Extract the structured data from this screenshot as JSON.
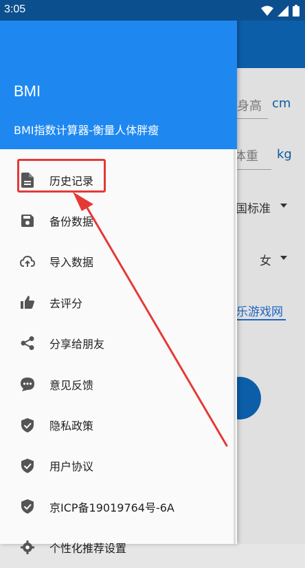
{
  "status_bar": {
    "time": "3:05"
  },
  "drawer": {
    "title": "BMI",
    "subtitle": "BMI指数计算器-衡量人体胖瘦",
    "items": [
      {
        "label": "历史记录",
        "icon": "document-icon"
      },
      {
        "label": "备份数据",
        "icon": "save-icon"
      },
      {
        "label": "导入数据",
        "icon": "cloud-upload-icon"
      },
      {
        "label": "去评分",
        "icon": "thumb-up-icon"
      },
      {
        "label": "分享给朋友",
        "icon": "share-icon"
      },
      {
        "label": "意见反馈",
        "icon": "feedback-icon"
      },
      {
        "label": "隐私政策",
        "icon": "shield-check-icon"
      },
      {
        "label": "用户协议",
        "icon": "shield-check-icon"
      },
      {
        "label": "京ICP备19019764号-6A",
        "icon": "shield-check-icon"
      },
      {
        "label": "个性化推荐设置",
        "icon": "gear-icon"
      }
    ]
  },
  "background": {
    "height_hint": "身高",
    "height_unit": "cm",
    "weight_hint": "体重",
    "weight_unit": "kg",
    "standard_value": "国标准",
    "gender_value": "女",
    "game_link": "乐游戏网"
  },
  "colors": {
    "header": "#1e88f0",
    "appbar": "#0c5ea8",
    "highlight": "#e53935",
    "icon": "#555555"
  }
}
